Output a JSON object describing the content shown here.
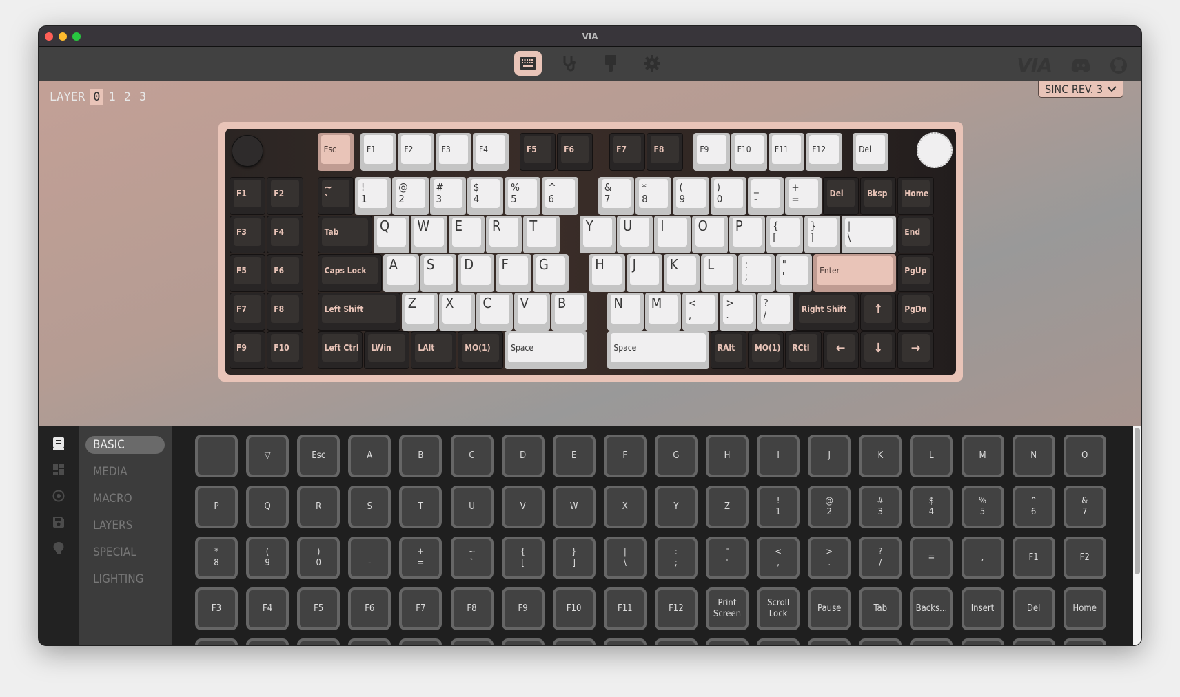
{
  "window": {
    "title": "VIA"
  },
  "traffic_lights": {
    "close": "#ff5f57",
    "minimize": "#febc2e",
    "maximize": "#28c840"
  },
  "navbar": {
    "tabs": [
      {
        "name": "configure",
        "icon": "keyboard-icon",
        "active": true
      },
      {
        "name": "test",
        "icon": "stethoscope-icon",
        "active": false
      },
      {
        "name": "design",
        "icon": "paintbrush-icon",
        "active": false
      },
      {
        "name": "settings",
        "icon": "gear-icon",
        "active": false
      }
    ],
    "right_icons": [
      "via-logo",
      "discord-icon",
      "github-icon"
    ],
    "logo_text": "VIA"
  },
  "colors": {
    "accent": "#e9c4b8",
    "dark_key": "#363230",
    "light_key": "#f0eff0"
  },
  "layer_selector": {
    "label": "LAYER",
    "layers": [
      "0",
      "1",
      "2",
      "3"
    ],
    "active": "0"
  },
  "keyboard_select": {
    "value": "SINC REV. 3"
  },
  "keyboard": {
    "keys": [
      {
        "l": "Esc",
        "t": "accent"
      },
      {
        "l": "F1",
        "t": "light"
      },
      {
        "l": "F2",
        "t": "light"
      },
      {
        "l": "F3",
        "t": "light"
      },
      {
        "l": "F4",
        "t": "light"
      },
      {
        "l": "F5",
        "t": "dark"
      },
      {
        "l": "F6",
        "t": "dark"
      },
      {
        "l": "F7",
        "t": "dark"
      },
      {
        "l": "F8",
        "t": "dark"
      },
      {
        "l": "F9",
        "t": "light"
      },
      {
        "l": "F10",
        "t": "light"
      },
      {
        "l": "F11",
        "t": "light"
      },
      {
        "l": "F12",
        "t": "light"
      },
      {
        "l": "Del",
        "t": "light"
      },
      {
        "l": "F1",
        "t": "dark"
      },
      {
        "l": "F2",
        "t": "dark"
      },
      {
        "l": "~\n`",
        "t": "dark",
        "dual": true
      },
      {
        "l": "!\n1",
        "t": "light",
        "dual": true
      },
      {
        "l": "@\n2",
        "t": "light",
        "dual": true
      },
      {
        "l": "#\n3",
        "t": "light",
        "dual": true
      },
      {
        "l": "$\n4",
        "t": "light",
        "dual": true
      },
      {
        "l": "%\n5",
        "t": "light",
        "dual": true
      },
      {
        "l": "^\n6",
        "t": "light",
        "dual": true
      },
      {
        "l": "&\n7",
        "t": "light",
        "dual": true
      },
      {
        "l": "*\n8",
        "t": "light",
        "dual": true
      },
      {
        "l": "(\n9",
        "t": "light",
        "dual": true
      },
      {
        "l": ")\n0",
        "t": "light",
        "dual": true
      },
      {
        "l": "_\n-",
        "t": "light",
        "dual": true
      },
      {
        "l": "+\n=",
        "t": "light",
        "dual": true
      },
      {
        "l": "Del",
        "t": "dark"
      },
      {
        "l": "Bksp",
        "t": "dark"
      },
      {
        "l": "Home",
        "t": "dark"
      },
      {
        "l": "F3",
        "t": "dark"
      },
      {
        "l": "F4",
        "t": "dark"
      },
      {
        "l": "Tab",
        "t": "dark"
      },
      {
        "l": "Q",
        "t": "light",
        "alpha": true
      },
      {
        "l": "W",
        "t": "light",
        "alpha": true
      },
      {
        "l": "E",
        "t": "light",
        "alpha": true
      },
      {
        "l": "R",
        "t": "light",
        "alpha": true
      },
      {
        "l": "T",
        "t": "light",
        "alpha": true
      },
      {
        "l": "Y",
        "t": "light",
        "alpha": true
      },
      {
        "l": "U",
        "t": "light",
        "alpha": true
      },
      {
        "l": "I",
        "t": "light",
        "alpha": true
      },
      {
        "l": "O",
        "t": "light",
        "alpha": true
      },
      {
        "l": "P",
        "t": "light",
        "alpha": true
      },
      {
        "l": "{\n[",
        "t": "light",
        "dual": true
      },
      {
        "l": "}\n]",
        "t": "light",
        "dual": true
      },
      {
        "l": "|\n\\",
        "t": "light",
        "dual": true
      },
      {
        "l": "End",
        "t": "dark"
      },
      {
        "l": "F5",
        "t": "dark"
      },
      {
        "l": "F6",
        "t": "dark"
      },
      {
        "l": "Caps Lock",
        "t": "dark"
      },
      {
        "l": "A",
        "t": "light",
        "alpha": true
      },
      {
        "l": "S",
        "t": "light",
        "alpha": true
      },
      {
        "l": "D",
        "t": "light",
        "alpha": true
      },
      {
        "l": "F",
        "t": "light",
        "alpha": true
      },
      {
        "l": "G",
        "t": "light",
        "alpha": true
      },
      {
        "l": "H",
        "t": "light",
        "alpha": true
      },
      {
        "l": "J",
        "t": "light",
        "alpha": true
      },
      {
        "l": "K",
        "t": "light",
        "alpha": true
      },
      {
        "l": "L",
        "t": "light",
        "alpha": true
      },
      {
        "l": ":\n;",
        "t": "light",
        "dual": true
      },
      {
        "l": "\"\n'",
        "t": "light",
        "dual": true
      },
      {
        "l": "Enter",
        "t": "accent"
      },
      {
        "l": "PgUp",
        "t": "dark"
      },
      {
        "l": "F7",
        "t": "dark"
      },
      {
        "l": "F8",
        "t": "dark"
      },
      {
        "l": "Left Shift",
        "t": "dark"
      },
      {
        "l": "Z",
        "t": "light",
        "alpha": true
      },
      {
        "l": "X",
        "t": "light",
        "alpha": true
      },
      {
        "l": "C",
        "t": "light",
        "alpha": true
      },
      {
        "l": "V",
        "t": "light",
        "alpha": true
      },
      {
        "l": "B",
        "t": "light",
        "alpha": true
      },
      {
        "l": "N",
        "t": "light",
        "alpha": true
      },
      {
        "l": "M",
        "t": "light",
        "alpha": true
      },
      {
        "l": "<\n,",
        "t": "light",
        "dual": true
      },
      {
        "l": ">\n.",
        "t": "light",
        "dual": true
      },
      {
        "l": "?\n/",
        "t": "light",
        "dual": true
      },
      {
        "l": "Right Shift",
        "t": "dark"
      },
      {
        "l": "↑",
        "t": "dark"
      },
      {
        "l": "PgDn",
        "t": "dark"
      },
      {
        "l": "F9",
        "t": "dark"
      },
      {
        "l": "F10",
        "t": "dark"
      },
      {
        "l": "Left Ctrl",
        "t": "dark"
      },
      {
        "l": "LWin",
        "t": "dark"
      },
      {
        "l": "LAlt",
        "t": "dark"
      },
      {
        "l": "MO(1)",
        "t": "dark"
      },
      {
        "l": "Space",
        "t": "light"
      },
      {
        "l": "Space",
        "t": "light"
      },
      {
        "l": "RAlt",
        "t": "dark"
      },
      {
        "l": "MO(1)",
        "t": "dark"
      },
      {
        "l": "RCtl",
        "t": "dark"
      },
      {
        "l": "←",
        "t": "dark"
      },
      {
        "l": "↓",
        "t": "dark"
      },
      {
        "l": "→",
        "t": "dark"
      }
    ]
  },
  "sidebar": {
    "icons": [
      "keycap-icon",
      "grid-icon",
      "record-icon",
      "save-icon",
      "bulb-icon"
    ],
    "categories": [
      {
        "label": "BASIC",
        "active": true
      },
      {
        "label": "MEDIA",
        "active": false
      },
      {
        "label": "MACRO",
        "active": false
      },
      {
        "label": "LAYERS",
        "active": false
      },
      {
        "label": "SPECIAL",
        "active": false
      },
      {
        "label": "LIGHTING",
        "active": false
      }
    ]
  },
  "keycodes": [
    "",
    "▽",
    "Esc",
    "A",
    "B",
    "C",
    "D",
    "E",
    "F",
    "G",
    "H",
    "I",
    "J",
    "K",
    "L",
    "M",
    "N",
    "O",
    "P",
    "Q",
    "R",
    "S",
    "T",
    "U",
    "V",
    "W",
    "X",
    "Y",
    "Z",
    "!\n1",
    "@\n2",
    "#\n3",
    "$\n4",
    "%\n5",
    "^\n6",
    "&\n7",
    "*\n8",
    "(\n9",
    ")\n0",
    "_\n-",
    "+\n=",
    "~\n`",
    "{\n[",
    "}\n]",
    "|\n\\",
    ":\n;",
    "\"\n'",
    "<\n,",
    ">\n.",
    "?\n/",
    "=",
    ",",
    "F1",
    "F2",
    "F3",
    "F4",
    "F5",
    "F6",
    "F7",
    "F8",
    "F9",
    "F10",
    "F11",
    "F12",
    "Print\nScreen",
    "Scroll\nLock",
    "Pause",
    "Tab",
    "Backs...",
    "Insert",
    "Del",
    "Home",
    "",
    "",
    "",
    "",
    "",
    "",
    "",
    "",
    "",
    "",
    "",
    "",
    "",
    "",
    "",
    "",
    "",
    ""
  ]
}
